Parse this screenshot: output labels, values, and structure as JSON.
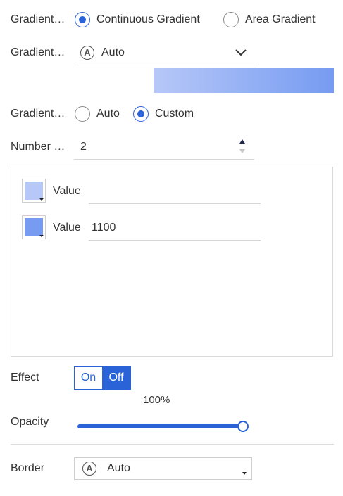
{
  "gradient_type": {
    "label": "Gradient…",
    "options": [
      "Continuous Gradient",
      "Area Gradient"
    ],
    "selected": "Continuous Gradient"
  },
  "gradient_color": {
    "label": "Gradient…",
    "value": "Auto",
    "icon": "auto-icon",
    "preview_colors": [
      "#b7c8f8",
      "#769bf1"
    ]
  },
  "gradient_range": {
    "label": "Gradient…",
    "options": [
      "Auto",
      "Custom"
    ],
    "selected": "Custom"
  },
  "number": {
    "label": "Number …",
    "value": "2"
  },
  "stops": [
    {
      "label": "Value",
      "value": "",
      "color": "#b7c8f8"
    },
    {
      "label": "Value",
      "value": "1100",
      "color": "#769bf1"
    }
  ],
  "effect": {
    "label": "Effect",
    "on_label": "On",
    "off_label": "Off",
    "selected": "Off"
  },
  "opacity": {
    "label": "Opacity",
    "value_text": "100%",
    "fraction": 1.0
  },
  "border": {
    "label": "Border",
    "value": "Auto"
  },
  "colors": {
    "accent": "#2a62d8"
  }
}
